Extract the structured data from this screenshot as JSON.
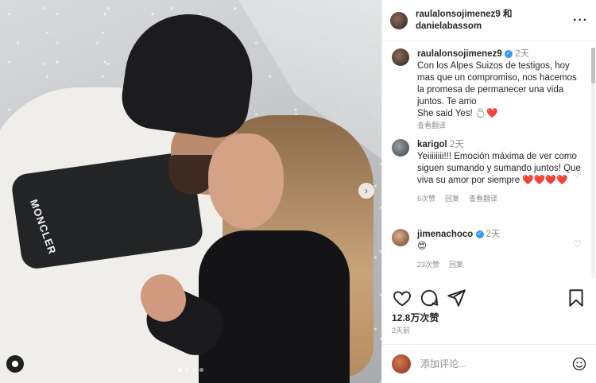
{
  "post": {
    "header": {
      "author": "raulalonsojimenez9",
      "connector": "和",
      "coauthor": "danielabassom",
      "more_icon": "more-horizontal-icon"
    },
    "carousel": {
      "next_icon": "chevron-right-icon",
      "tag_icon": "user-tag-icon",
      "current_slide": 1,
      "total_slides": 4,
      "brand_text": "MONCLER"
    }
  },
  "comments": [
    {
      "username": "raulalonsojimenez9",
      "verified": true,
      "time": "2天",
      "text_lines": [
        "Con los Alpes Suizos de testigos, hoy mas que un compromiso, nos hacemos la promesa de permanecer una vida juntos. Te amo",
        "She said Yes! 💍❤️"
      ],
      "actions": [
        "查看翻译"
      ]
    },
    {
      "username": "karigol",
      "verified": false,
      "time": "2天",
      "text_lines": [
        "Yeiiiiiiii!!! Emoción máxima de ver como siguen sumando y sumando juntos! Que viva su amor por siempre ❤️❤️❤️❤️"
      ],
      "likes": "6次赞",
      "actions": [
        "回复",
        "查看翻译"
      ]
    },
    {
      "username": "jimenachoco",
      "verified": true,
      "time": "2天",
      "text_lines": [
        "😍"
      ],
      "likes": "23次赞",
      "actions": [
        "回复"
      ]
    }
  ],
  "actions_bar": {
    "like_icon": "heart-icon",
    "comment_icon": "comment-icon",
    "share_icon": "send-icon",
    "save_icon": "bookmark-icon"
  },
  "stats": {
    "likes": "12.8万次赞",
    "posted": "2天前"
  },
  "compose": {
    "placeholder": "添加评论...",
    "emoji_icon": "emoji-icon"
  }
}
